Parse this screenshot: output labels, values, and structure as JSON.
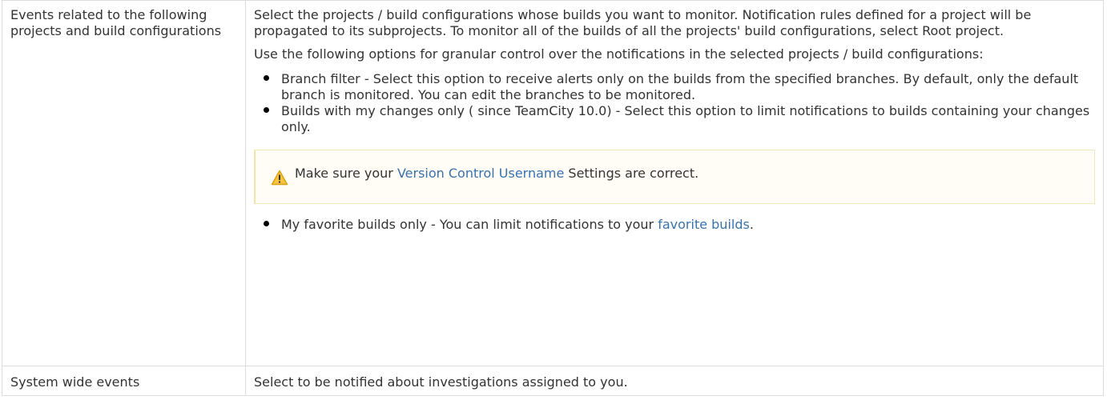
{
  "rows": [
    {
      "label": "Events related to the following projects and build configurations",
      "paragraph1": "Select the projects / build configurations whose builds you want to monitor.  Notification rules defined for a project will be propagated to its subprojects. To monitor all of the builds of all the projects' build configurations, select Root project.",
      "paragraph2": "Use the following options for granular control over the notifications in the selected projects / build configurations:",
      "bullets": [
        "Branch filter - Select this option to receive alerts only on the builds from the specified branches. By default, only the default branch is monitored. You can edit the branches to be monitored.",
        "Builds with my changes only ( since TeamCity 10.0)  - Select this option to limit notifications to builds containing your changes only."
      ],
      "warning": {
        "icon": "warning-triangle-icon",
        "before": "Make sure your ",
        "link": "Version Control Username",
        "after": " Settings are correct."
      },
      "last_bullet": {
        "before": "My favorite builds only - You can limit notifications to your ",
        "link": "favorite builds",
        "after": "."
      }
    },
    {
      "label": "System wide events",
      "description": "Select to be notified about investigations assigned to you."
    }
  ],
  "colors": {
    "link": "#3572b0",
    "text": "#333333",
    "border": "#dddddd",
    "warning_bg": "#fffdf6",
    "warning_border": "#f1e8b8",
    "warning_icon": "#f0b428"
  }
}
